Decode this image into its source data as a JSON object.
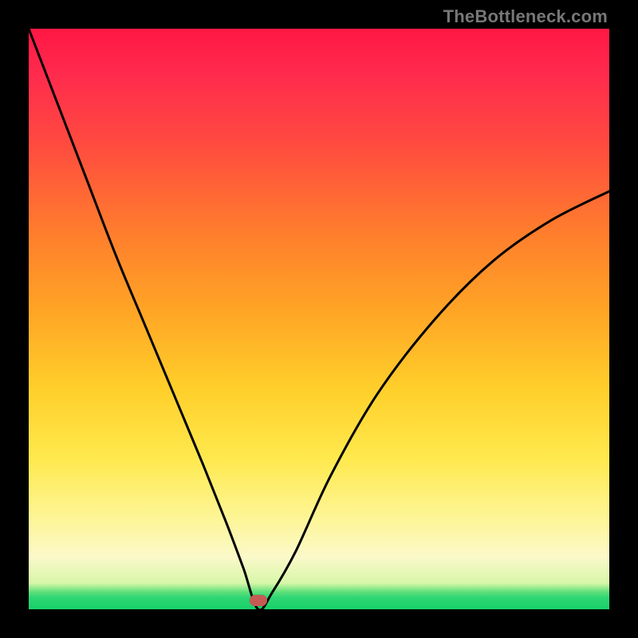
{
  "watermark": "TheBottleneck.com",
  "marker": {
    "x_frac": 0.395,
    "y_frac": 0.985
  },
  "chart_data": {
    "type": "line",
    "title": "",
    "xlabel": "",
    "ylabel": "",
    "xlim": [
      0,
      1
    ],
    "ylim": [
      0,
      1
    ],
    "series": [
      {
        "name": "bottleneck-curve",
        "x": [
          0.0,
          0.05,
          0.1,
          0.15,
          0.2,
          0.25,
          0.3,
          0.34,
          0.37,
          0.395,
          0.42,
          0.46,
          0.52,
          0.6,
          0.7,
          0.8,
          0.9,
          1.0
        ],
        "y": [
          1.0,
          0.87,
          0.74,
          0.61,
          0.49,
          0.37,
          0.25,
          0.15,
          0.07,
          0.0,
          0.03,
          0.1,
          0.23,
          0.37,
          0.5,
          0.6,
          0.67,
          0.72
        ]
      }
    ],
    "annotations": [
      {
        "type": "marker",
        "x": 0.395,
        "y": 0.015,
        "label": "optimal-point"
      }
    ],
    "grid": false,
    "legend": false
  }
}
